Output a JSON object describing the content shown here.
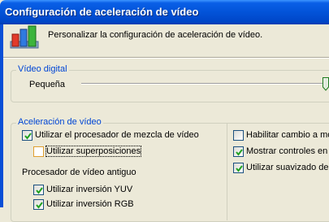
{
  "window": {
    "title": "Configuración de aceleración de vídeo"
  },
  "header": {
    "description": "Personalizar la configuración de aceleración de vídeo.",
    "icon": "video-settings-icon"
  },
  "digital_video": {
    "legend": "Vídeo digital",
    "slider_label": "Pequeña",
    "slider_level": 1.0
  },
  "acceleration": {
    "legend": "Aceleración de vídeo",
    "left_options": [
      {
        "label": "Utilizar el procesador de mezcla de vídeo",
        "checked": true
      },
      {
        "label": "Utilizar superposiciones",
        "checked": false,
        "enabled": false
      }
    ],
    "legacy_heading": "Procesador de vídeo antiguo",
    "legacy_options": [
      {
        "label": "Utilizar inversión YUV",
        "checked": true
      },
      {
        "label": "Utilizar inversión RGB",
        "checked": true
      }
    ],
    "right_options": [
      {
        "label": "Habilitar cambio a mo",
        "checked": false
      },
      {
        "label": "Mostrar controles en p",
        "checked": true
      },
      {
        "label": "Utilizar suavizado de v",
        "checked": true
      }
    ]
  }
}
